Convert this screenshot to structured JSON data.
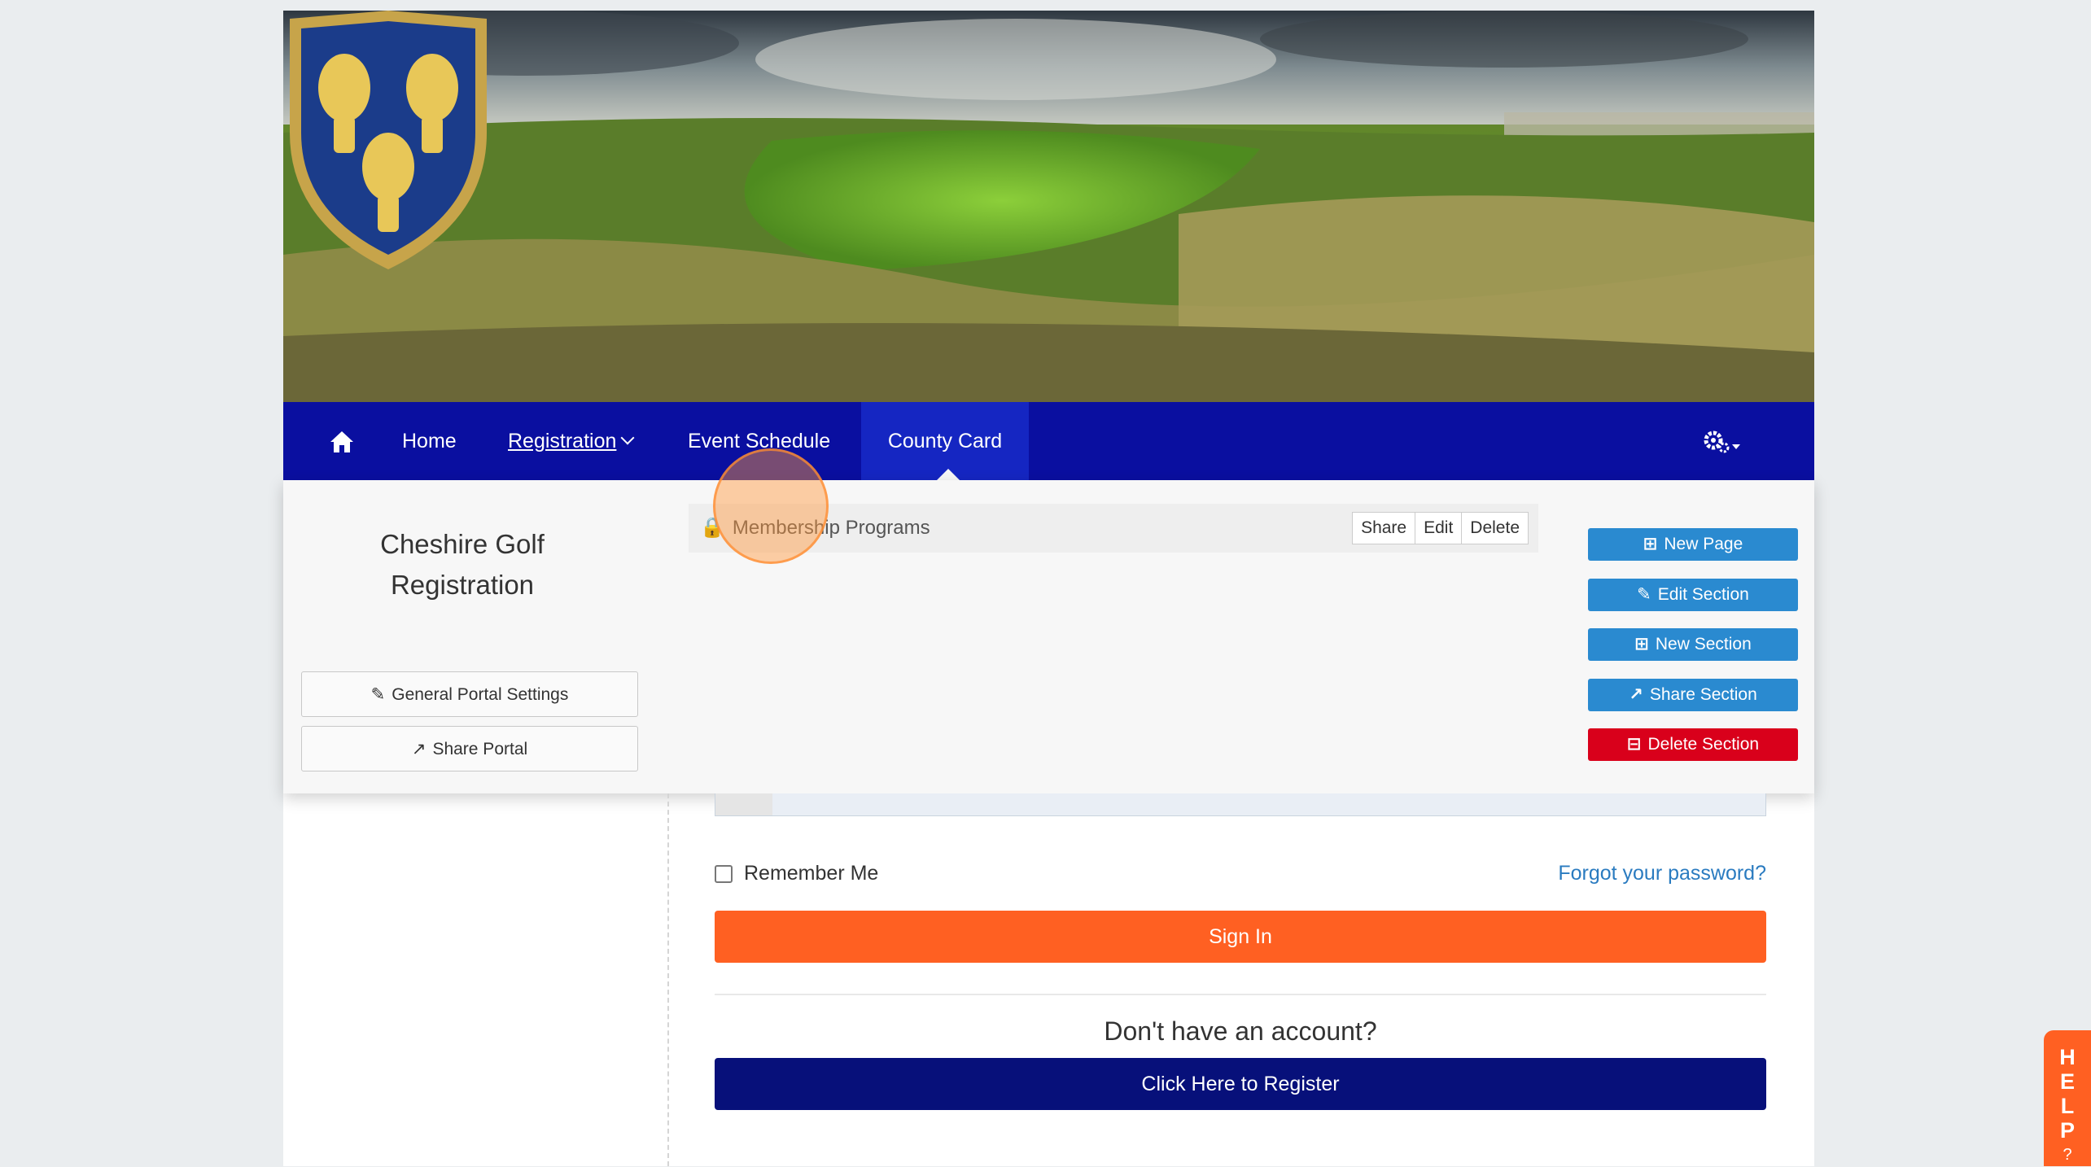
{
  "nav": {
    "home_icon": "home-icon",
    "items": [
      "Home",
      "Registration",
      "Event Schedule",
      "County Card"
    ],
    "active": "County Card",
    "settings_icon": "gears-icon"
  },
  "admin": {
    "portal_title_line1": "Cheshire Golf",
    "portal_title_line2": "Registration",
    "general_settings": "General Portal Settings",
    "share_portal": "Share Portal",
    "section_title": "Membership Programs",
    "section_buttons": [
      "Share",
      "Edit",
      "Delete"
    ],
    "actions": {
      "new_page": "New Page",
      "edit_section": "Edit Section",
      "new_section": "New Section",
      "share_section": "Share Section",
      "delete_section": "Delete Section"
    }
  },
  "login": {
    "remember_me": "Remember Me",
    "forgot_password": "Forgot your password?",
    "sign_in": "Sign In",
    "no_account": "Don't have an account?",
    "register": "Click Here to Register"
  },
  "help": {
    "letters": [
      "H",
      "E",
      "L",
      "P",
      "?"
    ]
  },
  "colors": {
    "nav_bg": "#0a0fa0",
    "nav_active": "#1526c2",
    "action_blue": "#2a8ad0",
    "delete_red": "#d9001b",
    "sign_in_orange": "#ff6022",
    "register_navy": "#07107a",
    "link_blue": "#2a7bc0"
  }
}
